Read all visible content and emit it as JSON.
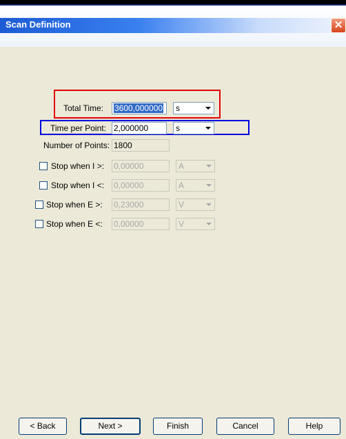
{
  "window": {
    "title": "Scan Definition",
    "close_glyph": "✕"
  },
  "form": {
    "total_time": {
      "label": "Total Time:",
      "value": "3600,000000",
      "unit": "s"
    },
    "time_per_point": {
      "label": "Time per Point:",
      "value": "2,000000",
      "unit": "s"
    },
    "number_of_points": {
      "label": "Number of Points:",
      "value": "1800"
    },
    "stop_i_gt": {
      "label": "Stop when I >:",
      "value": "0,00000",
      "unit": "A",
      "checked": false
    },
    "stop_i_lt": {
      "label": "Stop when I <:",
      "value": "0,00000",
      "unit": "A",
      "checked": false
    },
    "stop_e_gt": {
      "label": "Stop when E >:",
      "value": "0,23000",
      "unit": "V",
      "checked": false
    },
    "stop_e_lt": {
      "label": "Stop when E <:",
      "value": "0,00000",
      "unit": "V",
      "checked": false
    }
  },
  "buttons": {
    "back": "< Back",
    "next": "Next >",
    "finish": "Finish",
    "cancel": "Cancel",
    "help": "Help"
  },
  "colors": {
    "highlight_red": "#e00000",
    "highlight_blue": "#0000e0",
    "title_bar": "#1c5bd4"
  }
}
